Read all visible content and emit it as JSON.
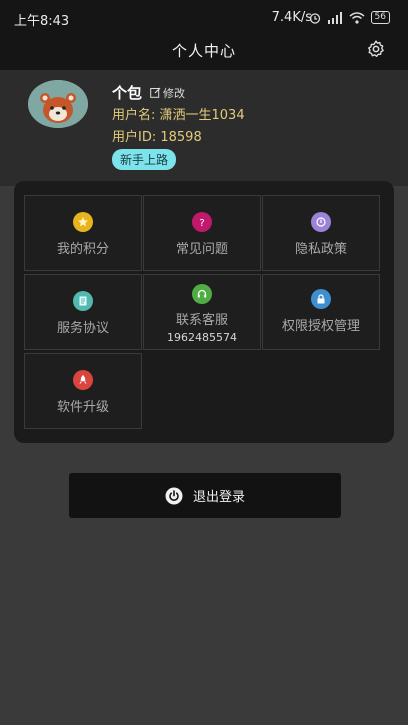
{
  "status_bar": {
    "time": "上午8:43",
    "speed": "7.4K/s",
    "battery": "56"
  },
  "header": {
    "title": "个人中心",
    "settings_icon": "gear-icon"
  },
  "profile": {
    "nickname": "个包",
    "edit_label": "修改",
    "username_line": "用户名: 潇洒一生1034",
    "userid_line": "用户ID: 18598",
    "tag": "新手上路"
  },
  "menu": [
    {
      "label": "我的积分",
      "icon": "star-icon",
      "color": "#e8b41e"
    },
    {
      "label": "常见问题",
      "icon": "question-icon",
      "color": "#c2186b"
    },
    {
      "label": "隐私政策",
      "icon": "privacy-icon",
      "color": "#9c83d8"
    },
    {
      "label": "服务协议",
      "icon": "document-icon",
      "color": "#52b9b0"
    },
    {
      "label": "联系客服",
      "sub": "1962485574",
      "icon": "customer-service-icon",
      "color": "#4fae43"
    },
    {
      "label": "权限授权管理",
      "icon": "lock-icon",
      "color": "#3f8ed0"
    },
    {
      "label": "软件升级",
      "icon": "rocket-icon",
      "color": "#d9463f"
    }
  ],
  "logout": {
    "label": "退出登录",
    "icon": "power-icon"
  },
  "colors": {
    "accent_tag": "#7ce3ea",
    "info_text": "#e2cc7b",
    "background": "#3a3a3a"
  }
}
